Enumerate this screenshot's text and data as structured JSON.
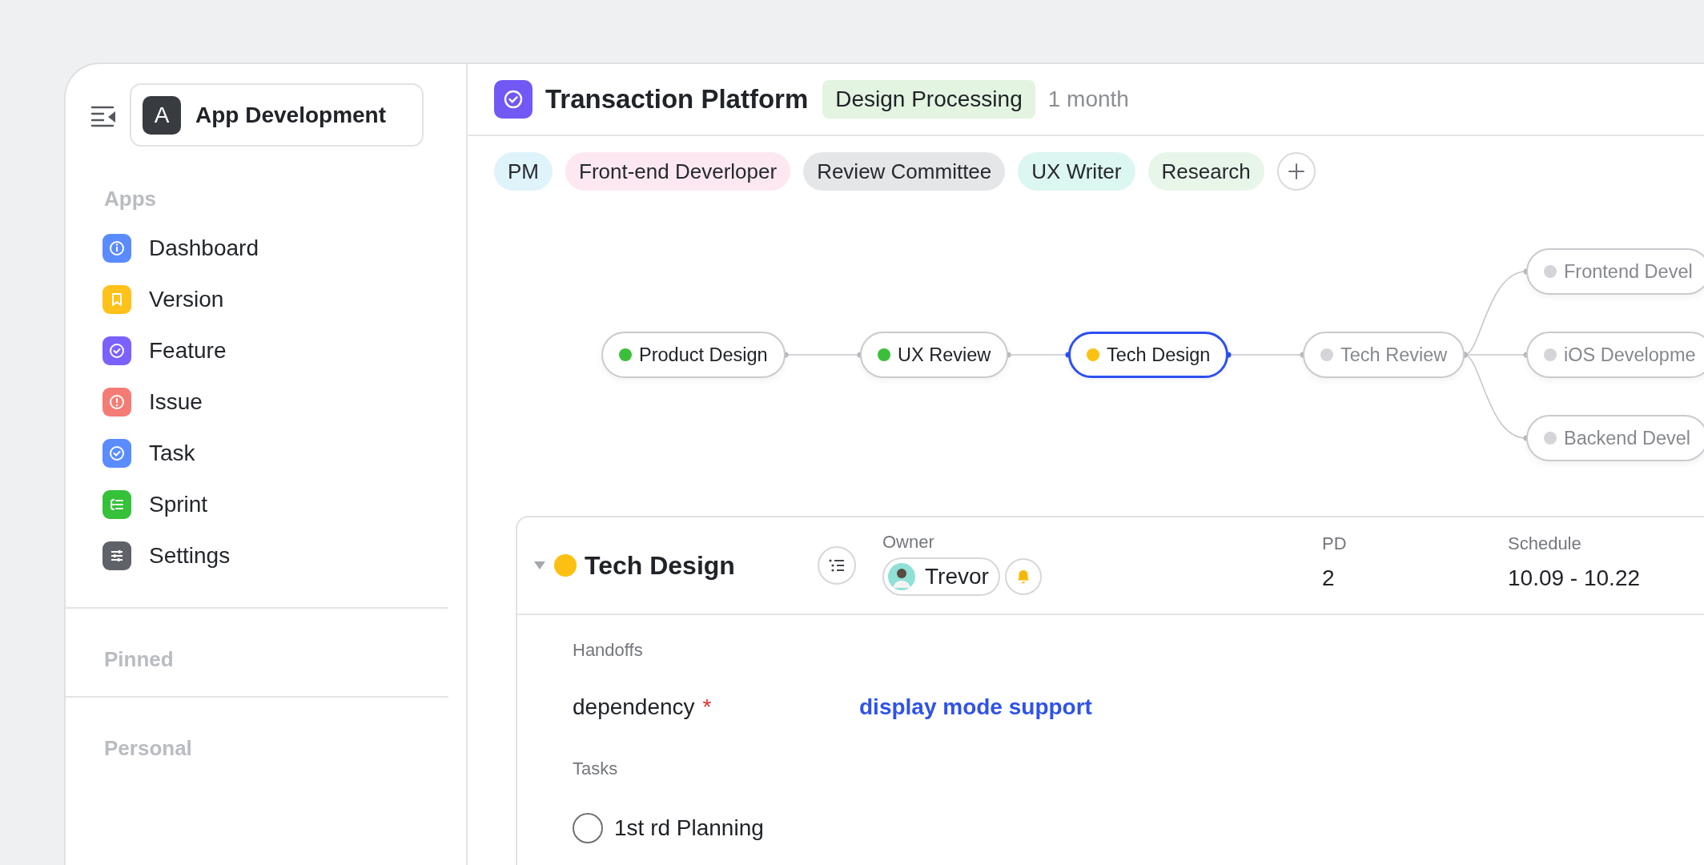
{
  "sidebar": {
    "workspace": {
      "initial": "A",
      "name": "App Development"
    },
    "sections": [
      {
        "title": "Apps",
        "items": [
          {
            "label": "Dashboard",
            "kind": "info",
            "color": "#5b8cff"
          },
          {
            "label": "Version",
            "kind": "bookmark",
            "color": "#ffc21a"
          },
          {
            "label": "Feature",
            "kind": "check",
            "color": "#7b61ff"
          },
          {
            "label": "Issue",
            "kind": "alert",
            "color": "#f47c74"
          },
          {
            "label": "Task",
            "kind": "check",
            "color": "#5b8cff"
          },
          {
            "label": "Sprint",
            "kind": "sprint",
            "color": "#35c13a"
          },
          {
            "label": "Settings",
            "kind": "sliders",
            "color": "#5f6369"
          }
        ]
      },
      {
        "title": "Pinned"
      },
      {
        "title": "Personal"
      }
    ]
  },
  "header": {
    "title": "Transaction Platform",
    "status": "Design Processing",
    "duration": "1 month"
  },
  "roles": [
    {
      "label": "PM",
      "color": "#dff3fb"
    },
    {
      "label": "Front-end Deverloper",
      "color": "#fde8f1"
    },
    {
      "label": "Review Committee",
      "color": "#e5e6e8"
    },
    {
      "label": "UX Writer",
      "color": "#dcf6f1"
    },
    {
      "label": "Research",
      "color": "#e8f6e9"
    }
  ],
  "flow": {
    "nodes": [
      {
        "label": "Product Design",
        "color": "#3bbf3a",
        "disabled": false,
        "selected": false,
        "children": [
          {
            "label": "UX Review",
            "color": "#3bbf3a",
            "disabled": false,
            "selected": false,
            "children": [
              {
                "label": "Tech Design",
                "color": "#fbc012",
                "disabled": false,
                "selected": true,
                "children": [
                  {
                    "label": "Tech Review",
                    "color": "#d3d5d9",
                    "disabled": true,
                    "selected": false,
                    "children": [
                      {
                        "label": "Frontend Devel",
                        "color": "#d3d5d9",
                        "disabled": true,
                        "selected": false
                      },
                      {
                        "label": "iOS Developme",
                        "color": "#d3d5d9",
                        "disabled": true,
                        "selected": false
                      },
                      {
                        "label": "Backend Devel",
                        "color": "#d3d5d9",
                        "disabled": true,
                        "selected": false
                      }
                    ]
                  }
                ]
              }
            ]
          }
        ]
      }
    ]
  },
  "task": {
    "title": "Tech Design",
    "color": "#fbc012",
    "expanded": true,
    "owner": {
      "label": "Owner",
      "name": "Trevor"
    },
    "pd": {
      "label": "PD",
      "value": "2"
    },
    "schedule": {
      "label": "Schedule",
      "value": "10.09 - 10.22"
    },
    "handoffs": {
      "title": "Handoffs",
      "rows": [
        {
          "label": "dependency",
          "required_mark": "*",
          "value": "display mode support"
        }
      ]
    },
    "tasks": {
      "title": "Tasks",
      "items": [
        {
          "label": "1st rd Planning",
          "checked": false
        }
      ]
    }
  }
}
